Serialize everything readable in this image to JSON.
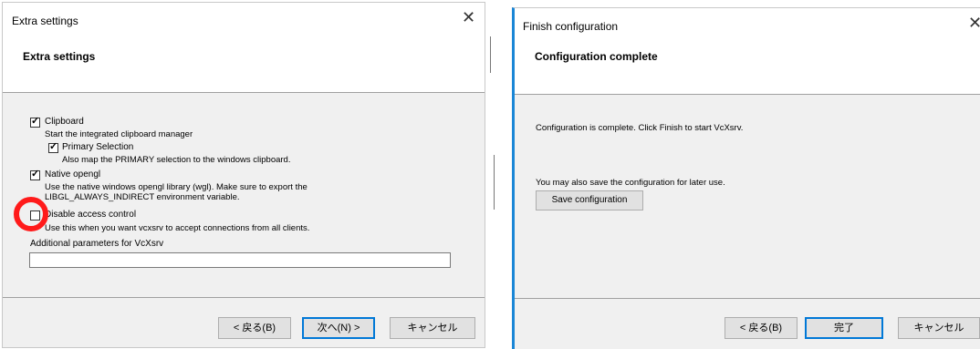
{
  "left_dialog": {
    "window_title": "Extra settings",
    "header_title": "Extra settings",
    "clipboard": {
      "label": "Clipboard",
      "checked": true,
      "description": "Start the integrated clipboard manager"
    },
    "primary_selection": {
      "label": "Primary Selection",
      "checked": true,
      "description": "Also map the PRIMARY selection to the windows clipboard."
    },
    "native_opengl": {
      "label": "Native opengl",
      "checked": true,
      "description_line1": "Use the native windows opengl library (wgl). Make sure to export the",
      "description_line2": "LIBGL_ALWAYS_INDIRECT environment variable."
    },
    "disable_access_control": {
      "label": "Disable access control",
      "checked": false,
      "description": "Use this when you want vcxsrv to accept connections from all clients."
    },
    "additional_params_label": "Additional parameters for VcXsrv",
    "additional_params_value": "",
    "buttons": {
      "back": "< 戻る(B)",
      "next": "次へ(N) >",
      "cancel": "キャンセル"
    },
    "highlight_color": "#ff1a1a"
  },
  "right_dialog": {
    "window_title": "Finish configuration",
    "header_title": "Configuration complete",
    "complete_message": "Configuration is complete. Click Finish to start VcXsrv.",
    "save_message": "You may also save the configuration for later use.",
    "save_button": "Save configuration",
    "buttons": {
      "back": "< 戻る(B)",
      "finish": "完了",
      "cancel": "キャンセル"
    },
    "accent_color": "#1a86d6"
  },
  "icons": {
    "close": "close-icon",
    "check": "checkmark-icon"
  }
}
